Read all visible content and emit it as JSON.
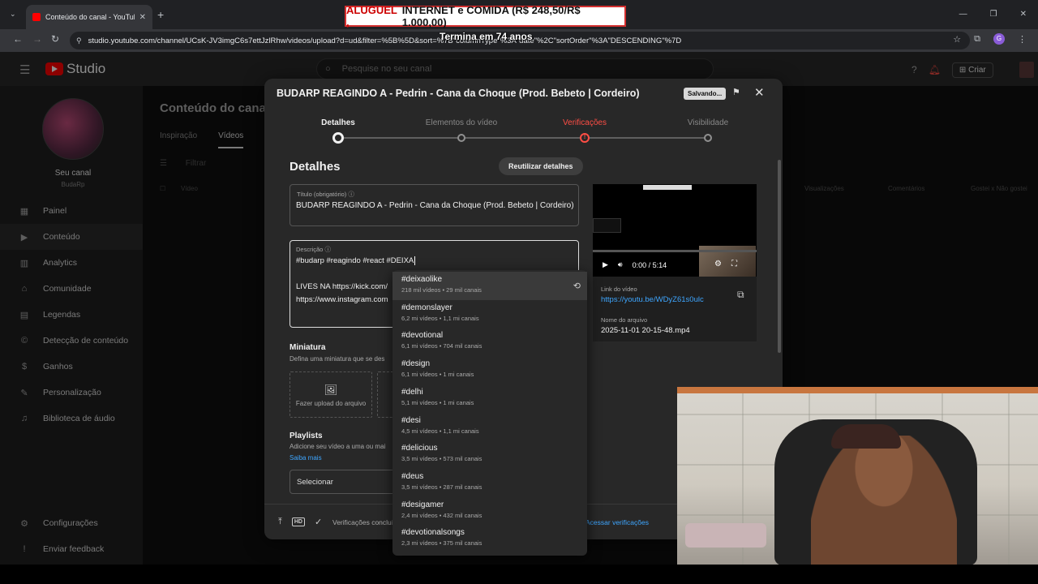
{
  "browser": {
    "tab_title": "Conteúdo do canal - YouTube Studio",
    "url": "studio.youtube.com/channel/UCsK-JV3imgC6s7ettJzlRhw/videos/upload?d=ud&filter=%5B%5D&sort=%7B\"columnType\"%3A\"date\"%2C\"sortOrder\"%3A\"DESCENDING\"%7D",
    "profile_letter": "G"
  },
  "overlay": {
    "banner_red": "ALUGUEL , ",
    "banner_black": "INTERNET e COMIDA (R$ 248,50/R$ 1.000,00)",
    "timer": "Termina em 74 anos"
  },
  "header": {
    "logo": "Studio",
    "search_placeholder": "Pesquise no seu canal",
    "create_label": "Criar"
  },
  "sidebar": {
    "channel_name": "Seu canal",
    "channel_handle": "BudaRp",
    "items": [
      {
        "label": "Painel",
        "icon": "dashboard-icon"
      },
      {
        "label": "Conteúdo",
        "icon": "content-icon"
      },
      {
        "label": "Analytics",
        "icon": "analytics-icon"
      },
      {
        "label": "Comunidade",
        "icon": "community-icon"
      },
      {
        "label": "Legendas",
        "icon": "subtitles-icon"
      },
      {
        "label": "Detecção de conteúdo",
        "icon": "copyright-icon"
      },
      {
        "label": "Ganhos",
        "icon": "earn-icon"
      },
      {
        "label": "Personalização",
        "icon": "customization-icon"
      },
      {
        "label": "Biblioteca de áudio",
        "icon": "audio-library-icon"
      }
    ],
    "settings_label": "Configurações",
    "feedback_label": "Enviar feedback"
  },
  "page": {
    "title": "Conteúdo do canal",
    "tabs": [
      "Inspiração",
      "Vídeos"
    ],
    "filter_placeholder": "Filtrar",
    "col_video": "Vídeo",
    "col_views": "Visualizações",
    "col_comments": "Comentários",
    "col_likes": "Gostei x Não gostei"
  },
  "dialog": {
    "title": "BUDARP REAGINDO A - Pedrin - Cana da Choque (Prod. Bebeto | Cordeiro)",
    "saving": "Salvando...",
    "steps": [
      "Detalhes",
      "Elementos do vídeo",
      "Verificações",
      "Visibilidade"
    ],
    "heading": "Detalhes",
    "reuse_label": "Reutilizar detalhes",
    "title_label": "Título (obrigatório)",
    "title_value": "BUDARP REAGINDO A - Pedrin - Cana da Choque (Prod. Bebeto | Cordeiro)",
    "desc_label": "Descrição",
    "desc_line1": "#budarp #reagindo #react #DEIXA",
    "desc_line2": "LIVES NA https://kick.com/",
    "desc_line3": "https://www.instagram.com",
    "thumb_heading": "Miniatura",
    "thumb_sub": "Defina uma miniatura que se des",
    "upload_label": "Fazer upload do arquivo",
    "playlists_heading": "Playlists",
    "playlists_sub": "Adicione seu vídeo a uma ou mai",
    "learn_more": "Saiba mais",
    "select_label": "Selecionar",
    "footer_text": "Verificações concluí",
    "footer_link": "Acessar verificações"
  },
  "video": {
    "time": "0:00 / 5:14",
    "link_label": "Link do vídeo",
    "link": "https://youtu.be/WDyZ61s0ulc",
    "file_label": "Nome do arquivo",
    "file_name": "2025-11-01 20-15-48.mp4"
  },
  "suggestions": [
    {
      "tag": "#deixaolike",
      "meta": "218 mil vídeos • 29 mil canais"
    },
    {
      "tag": "#demonslayer",
      "meta": "6,2 mi vídeos • 1,1 mi canais"
    },
    {
      "tag": "#devotional",
      "meta": "6,1 mi vídeos • 704 mil canais"
    },
    {
      "tag": "#design",
      "meta": "6,1 mi vídeos • 1 mi canais"
    },
    {
      "tag": "#delhi",
      "meta": "5,1 mi vídeos • 1 mi canais"
    },
    {
      "tag": "#desi",
      "meta": "4,5 mi vídeos • 1,1 mi canais"
    },
    {
      "tag": "#delicious",
      "meta": "3,5 mi vídeos • 573 mil canais"
    },
    {
      "tag": "#deus",
      "meta": "3,5 mi vídeos • 287 mil canais"
    },
    {
      "tag": "#desigamer",
      "meta": "2,4 mi vídeos • 432 mil canais"
    },
    {
      "tag": "#devotionalsongs",
      "meta": "2,3 mi vídeos • 375 mil canais"
    }
  ],
  "colors": {
    "accent": "#3ea6ff",
    "brand": "#ff0000",
    "warning": "#ff4e45"
  }
}
